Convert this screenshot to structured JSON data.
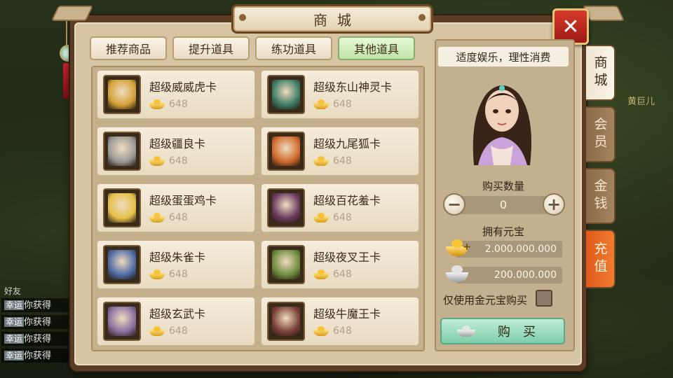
{
  "window": {
    "title": "商城"
  },
  "tabs": [
    {
      "label": "推荐商品",
      "active": false
    },
    {
      "label": "提升道具",
      "active": false
    },
    {
      "label": "练功道具",
      "active": false
    },
    {
      "label": "其他道具",
      "active": true
    }
  ],
  "items": [
    {
      "name": "超级威威虎卡",
      "price": "648",
      "color": "#d4a23a"
    },
    {
      "name": "超级东山神灵卡",
      "price": "648",
      "color": "#3d7a63"
    },
    {
      "name": "超级疆良卡",
      "price": "648",
      "color": "#9a9a96"
    },
    {
      "name": "超级九尾狐卡",
      "price": "648",
      "color": "#d06a2c"
    },
    {
      "name": "超级蛋蛋鸡卡",
      "price": "648",
      "color": "#e4c04a"
    },
    {
      "name": "超级百花羞卡",
      "price": "648",
      "color": "#6a3b5e"
    },
    {
      "name": "超级朱雀卡",
      "price": "648",
      "color": "#4c6aa4"
    },
    {
      "name": "超级夜叉王卡",
      "price": "648",
      "color": "#6d8b3c"
    },
    {
      "name": "超级玄武卡",
      "price": "648",
      "color": "#8a6fa0"
    },
    {
      "name": "超级牛魔王卡",
      "price": "648",
      "color": "#7a4036"
    }
  ],
  "right": {
    "slogan": "适度娱乐，理性消费",
    "qty_label": "购买数量",
    "qty_value": "0",
    "owned_label": "拥有元宝",
    "gold_amount": "2.000.000.000",
    "silver_amount": "200.000.000",
    "gold_only_label": "仅使用金元宝购买",
    "buy_label": "购买"
  },
  "side_tabs": [
    {
      "label": "商城",
      "active": true
    },
    {
      "label": "会员",
      "active": false
    },
    {
      "label": "金钱",
      "active": false
    },
    {
      "label": "充值",
      "active": false
    }
  ],
  "close_label": "✕",
  "background": {
    "side_text": "黄巨儿",
    "chat_prefix": "好友",
    "chat_lines": [
      {
        "tag": "幸运",
        "text": "你获得"
      },
      {
        "tag": "幸运",
        "text": "你获得"
      },
      {
        "tag": "幸运",
        "text": "你获得"
      },
      {
        "tag": "幸运",
        "text": "你获得"
      }
    ]
  }
}
